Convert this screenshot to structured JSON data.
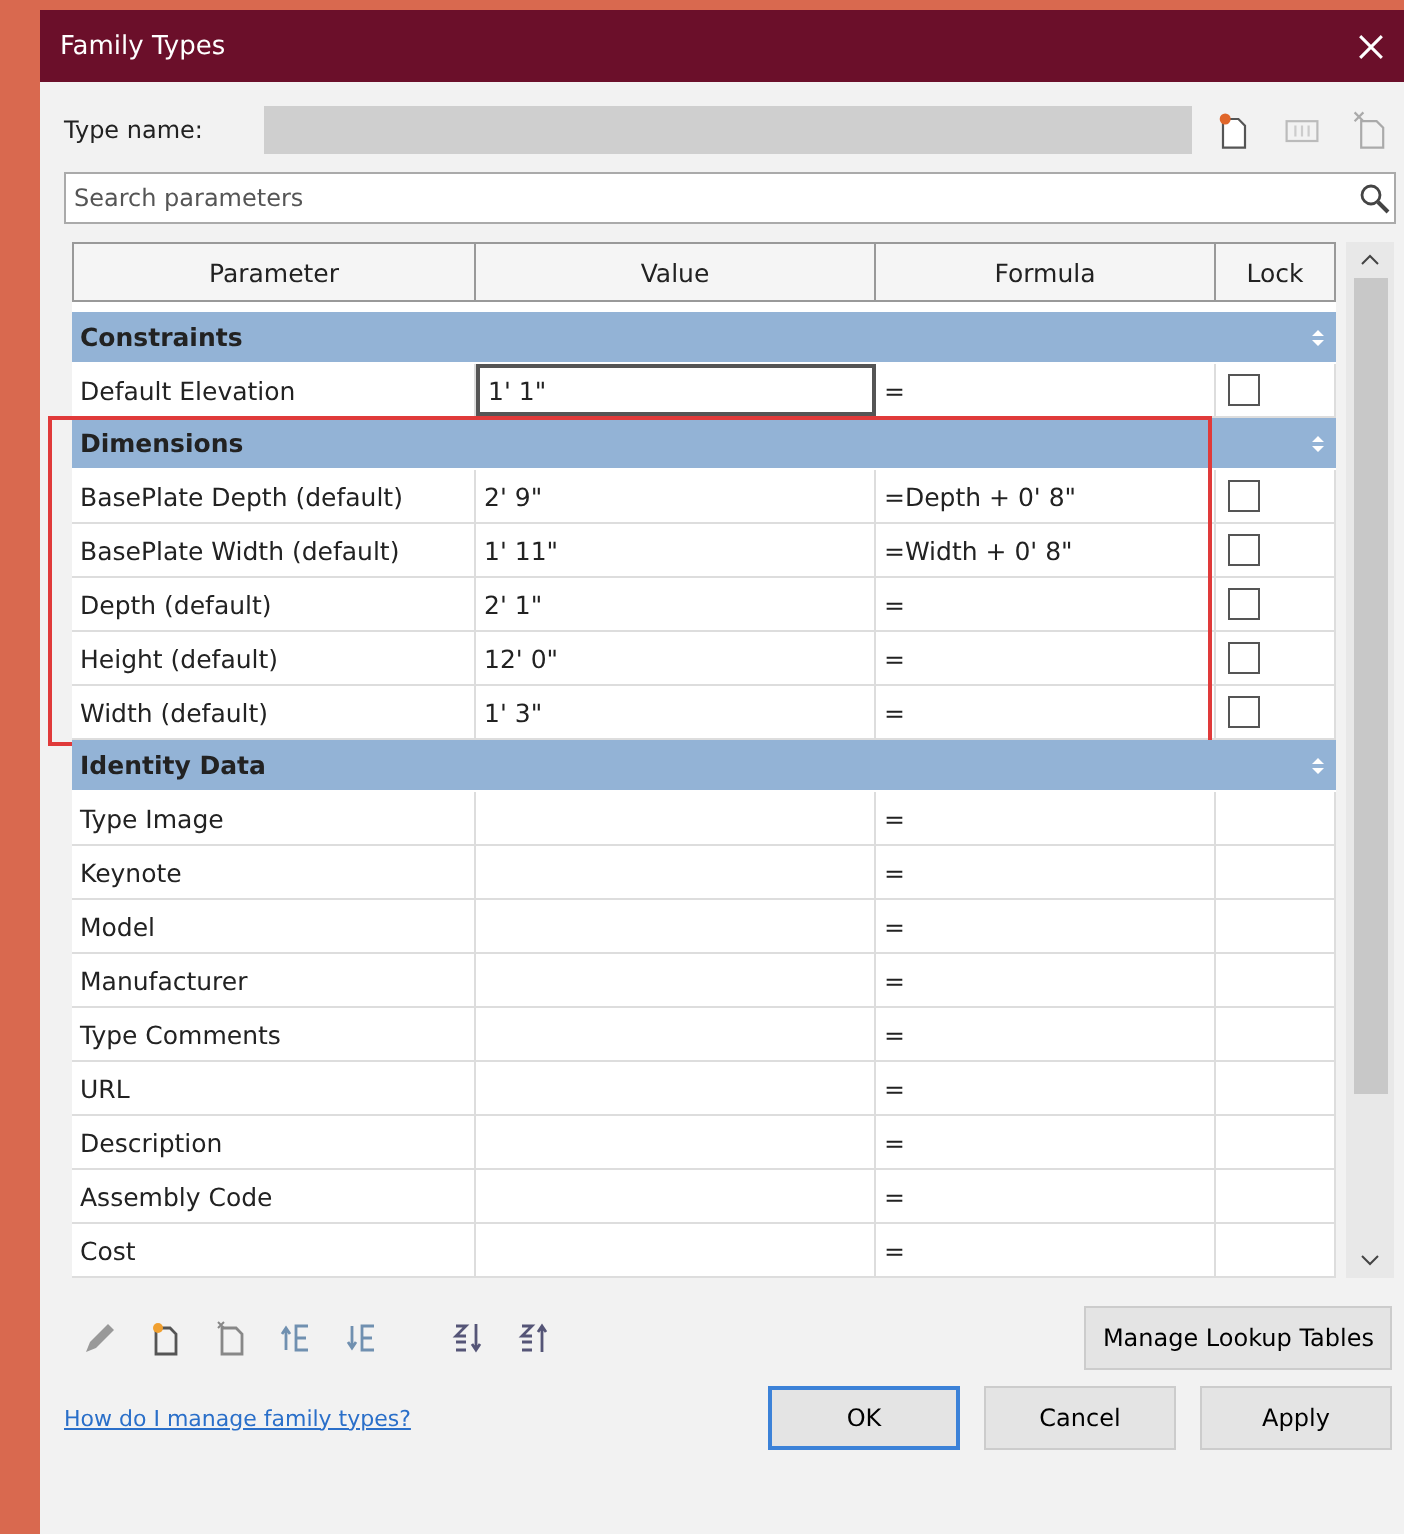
{
  "window": {
    "title": "Family Types"
  },
  "type_name": {
    "label": "Type name:"
  },
  "search": {
    "placeholder": "Search parameters"
  },
  "table": {
    "columns": [
      "Parameter",
      "Value",
      "Formula",
      "Lock"
    ],
    "groups": [
      {
        "name": "Constraints",
        "highlighted": false,
        "rows": [
          {
            "parameter": "Default Elevation",
            "value": "1' 1\"",
            "formula": "=",
            "lock": false,
            "editing": true
          }
        ]
      },
      {
        "name": "Dimensions",
        "highlighted": true,
        "rows": [
          {
            "parameter": "BasePlate Depth (default)",
            "value": "2' 9\"",
            "formula": "=Depth + 0' 8\"",
            "lock": false,
            "editing": false
          },
          {
            "parameter": "BasePlate Width (default)",
            "value": "1' 11\"",
            "formula": "=Width + 0' 8\"",
            "lock": false,
            "editing": false
          },
          {
            "parameter": "Depth (default)",
            "value": "2' 1\"",
            "formula": "=",
            "lock": false,
            "editing": false
          },
          {
            "parameter": "Height (default)",
            "value": "12' 0\"",
            "formula": "=",
            "lock": false,
            "editing": false
          },
          {
            "parameter": "Width (default)",
            "value": "1' 3\"",
            "formula": "=",
            "lock": false,
            "editing": false
          }
        ]
      },
      {
        "name": "Identity Data",
        "highlighted": false,
        "rows": [
          {
            "parameter": "Type Image",
            "formula": "="
          },
          {
            "parameter": "Keynote",
            "formula": "="
          },
          {
            "parameter": "Model",
            "formula": "="
          },
          {
            "parameter": "Manufacturer",
            "formula": "="
          },
          {
            "parameter": "Type Comments",
            "formula": "="
          },
          {
            "parameter": "URL",
            "formula": "="
          },
          {
            "parameter": "Description",
            "formula": "="
          },
          {
            "parameter": "Assembly Code",
            "formula": "="
          },
          {
            "parameter": "Cost",
            "formula": "="
          }
        ]
      }
    ]
  },
  "lookup_button": "Manage Lookup Tables",
  "help_link": "How do I manage family types?",
  "buttons": [
    {
      "label": "OK",
      "selected": true
    },
    {
      "label": "Cancel",
      "selected": false
    },
    {
      "label": "Apply",
      "selected": false
    }
  ]
}
